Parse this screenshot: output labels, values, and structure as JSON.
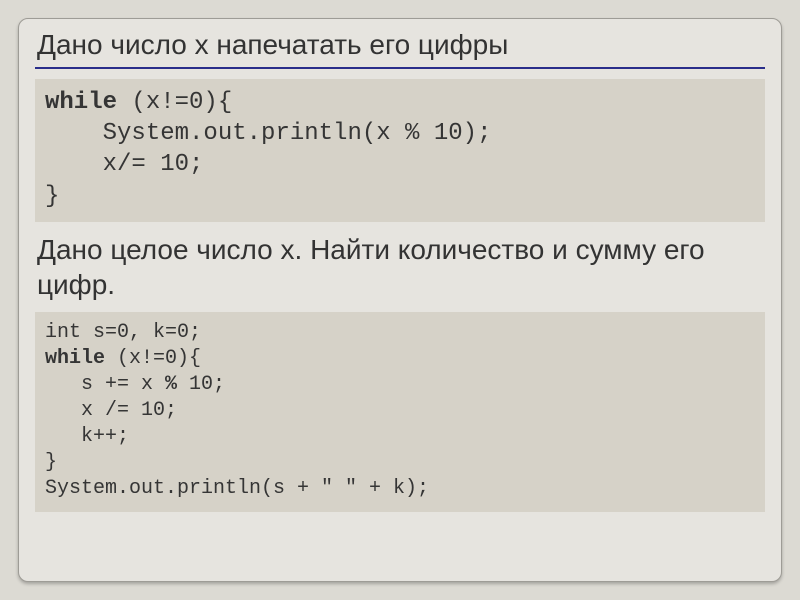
{
  "title": "Дано число x напечатать его цифры",
  "code1": {
    "l1a": "while",
    "l1b": " (x!=0){",
    "l2": "    System.out.println(x % 10);",
    "l3": "    x/= 10;",
    "l4": "}"
  },
  "subtitle": "Дано целое число x. Найти количество и сумму его цифр.",
  "code2": {
    "l1": "int s=0, k=0;",
    "l2a": "while",
    "l2b": " (x!=0){",
    "l3a": "   s += x ",
    "l3b": "%",
    "l3c": " 10;",
    "l4": "   x /= 10;",
    "l5": "   k++;",
    "l6": "}",
    "l7": "System.out.println(s + \" \" + k);"
  }
}
